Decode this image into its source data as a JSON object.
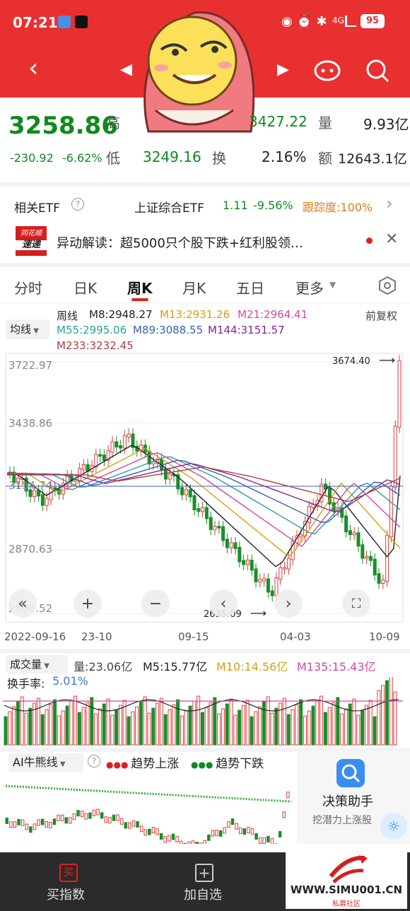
{
  "status_bar": {
    "time": "07:21",
    "battery": "95",
    "network": "4G"
  },
  "quote": {
    "price": "3258.86",
    "change": "-230.92",
    "change_pct": "-6.62%",
    "labels": {
      "high": "高",
      "low": "低",
      "volume": "量",
      "turnover": "换",
      "amount": "额"
    },
    "high": "3427.22",
    "low": "3249.16",
    "volume": "9.93亿",
    "turnover_rate": "2.16%",
    "amount": "12643.1亿"
  },
  "etf": {
    "label": "相关ETF",
    "name": "上证综合ETF",
    "price": "1.11",
    "pct": "-9.56%",
    "tracking": "跟踪度:100%"
  },
  "news": {
    "logo_top": "同花顺",
    "logo_bottom": "速递",
    "text": "异动解读：超5000只个股下跌+红利股领…"
  },
  "tabs": [
    "分时",
    "日K",
    "周K",
    "月K",
    "五日",
    "更多"
  ],
  "active_tab": "周K",
  "ma_panel": {
    "selector": "均线",
    "period": "周线",
    "adjust": "前复权",
    "lines": [
      {
        "t": "M8:2948.27",
        "c": "#222222"
      },
      {
        "t": "M13:2931.26",
        "c": "#d4a017"
      },
      {
        "t": "M21:2964.41",
        "c": "#d04a9e"
      },
      {
        "t": "M55:2995.06",
        "c": "#2e9c9c"
      },
      {
        "t": "M89:3088.55",
        "c": "#3a5fb8"
      },
      {
        "t": "M144:3151.57",
        "c": "#7a2a8a"
      },
      {
        "t": "M233:3232.45",
        "c": "#b04040"
      }
    ]
  },
  "price_axis": {
    "top": "3722.97",
    "mid_high": "3438.86",
    "mid": "3154.74",
    "mid_low": "2870.63",
    "bottom": "2586.52"
  },
  "annotations": {
    "max": "3674.40",
    "min": "2635.09"
  },
  "dates": [
    "2022-09-16",
    "23-10",
    "09-15",
    "04-03",
    "10-09"
  ],
  "volume_panel": {
    "selector": "成交量",
    "vol": "量:23.06亿",
    "m5": "M5:15.77亿",
    "m10": "M10:14.56亿",
    "m135": "M135:15.43亿",
    "turnover_label": "换手率:",
    "turnover": "5.01%"
  },
  "ai_panel": {
    "selector": "AI牛熊线",
    "up": "趋势上涨",
    "down": "趋势下跌"
  },
  "assistant": {
    "title": "决策助手",
    "subtitle": "挖潜力上涨股"
  },
  "bottom": {
    "buy": "买指数",
    "add": "加自选",
    "buy_icon": "买"
  },
  "watermark": {
    "site": "WWW.SIMU001.CN",
    "sub": "私募社区"
  }
}
